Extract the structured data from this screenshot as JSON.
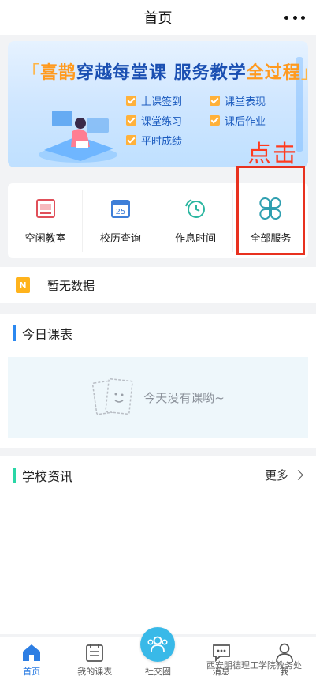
{
  "header": {
    "title": "首页"
  },
  "banner": {
    "headline_bracket_left": "「",
    "headline_accent": "喜鹊",
    "headline_main": "穿越每堂课 服务教学",
    "headline_accent2": "全过程",
    "headline_bracket_right": "」",
    "features": [
      "上课签到",
      "课堂表现",
      "课堂练习",
      "课后作业",
      "平时成绩"
    ]
  },
  "annotation": {
    "tap_hint": "点击"
  },
  "services": [
    {
      "label": "空闲教室",
      "icon": "classroom-icon"
    },
    {
      "label": "校历查询",
      "icon": "calendar-icon",
      "badge": "25"
    },
    {
      "label": "作息时间",
      "icon": "clock-icon"
    },
    {
      "label": "全部服务",
      "icon": "all-services-icon"
    }
  ],
  "notice": {
    "icon_letter": "N",
    "text": "暂无数据"
  },
  "schedule": {
    "title": "今日课表",
    "empty_text": "今天没有课哟~"
  },
  "news": {
    "title": "学校资讯",
    "more": "更多"
  },
  "tabbar": [
    {
      "label": "首页",
      "active": true
    },
    {
      "label": "我的课表",
      "active": false
    },
    {
      "label": "社交圈",
      "active": false
    },
    {
      "label": "消息",
      "active": false
    },
    {
      "label": "我",
      "active": false
    }
  ],
  "watermark": "西安明德理工学院教务处",
  "colors": {
    "primary": "#2d7ee3",
    "accent": "#ffb13a",
    "highlight": "#e8311f",
    "teal": "#2ad6a6"
  }
}
